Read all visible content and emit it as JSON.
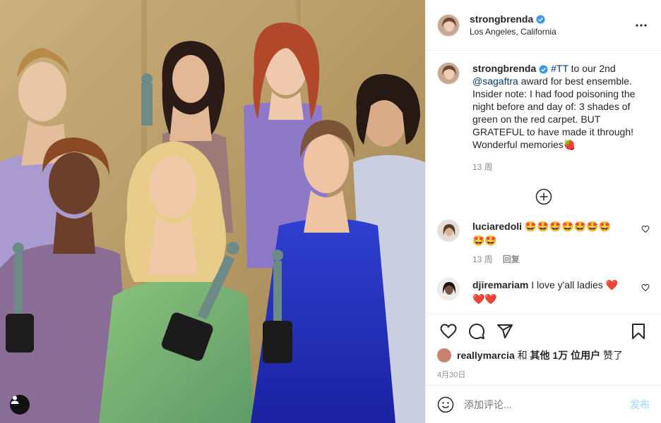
{
  "post": {
    "username": "strongbrenda",
    "location": "Los Angeles, California"
  },
  "caption": {
    "username": "strongbrenda",
    "hashtag": "#TT",
    "text_1": " to our 2nd ",
    "mention": "@sagaftra",
    "text_2": " award for best ensemble. Insider note: I had food poisoning the night before and day of: 3 shades of green on the red carpet. BUT GRATEFUL to have made it through! Wonderful memories",
    "emoji": "🍓",
    "time": "13 周"
  },
  "comments": [
    {
      "username": "luciaredoli",
      "text": "🤩🤩🤩🤩🤩🤩🤩🤩🤩",
      "time": "13 周",
      "reply": "回复"
    },
    {
      "username": "djiremariam",
      "text": "I love y'all ladies ❤️❤️❤️",
      "time": "",
      "reply": ""
    }
  ],
  "likes": {
    "user": "reallymarcia",
    "rest": " 和 ",
    "others": "其他 1万 位用户",
    "suffix": " 赞了"
  },
  "date": "4月30日",
  "add_comment": {
    "placeholder": "添加评论...",
    "post_label": "发布"
  },
  "colors": {
    "link": "#00376b",
    "verified": "#3897f0",
    "muted": "#8e8e8e",
    "post_button": "#b2dffc"
  },
  "icons": [
    "verified-badge-icon",
    "more-options-icon",
    "load-more-icon",
    "heart-icon",
    "comment-icon",
    "share-icon",
    "bookmark-icon",
    "emoji-icon",
    "user-tag-icon"
  ]
}
